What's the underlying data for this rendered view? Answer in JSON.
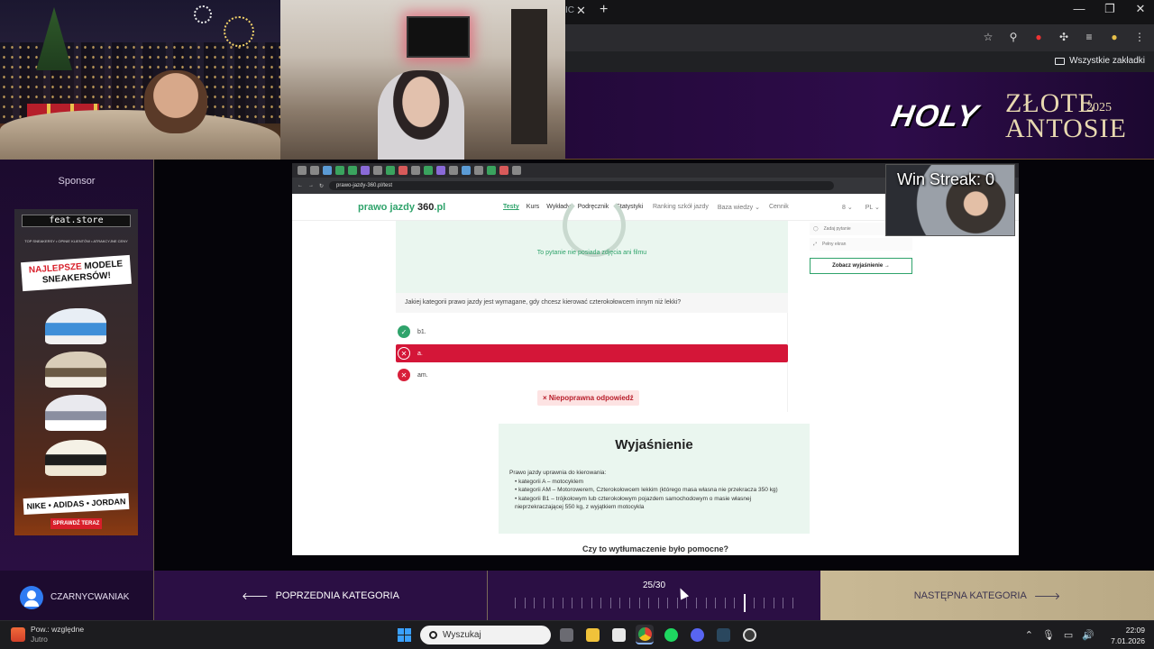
{
  "stream": {
    "sponsor_label": "Sponsor",
    "ad": {
      "logo": "feat.store",
      "tagline": "TOP SNEAKERSY • OPINIE KLIENTÓW • ATRAKCYJNE CENY",
      "headline_1": "NAJLEPSZE",
      "headline_2": "MODELE",
      "headline_3": "SNEAKERSÓW!",
      "brands": "NIKE • ADIDAS • JORDAN",
      "cta": "SPRAWDŹ TERAZ"
    },
    "banner": {
      "holy": "HOLY",
      "zlote": "ZŁOTE",
      "year": "2025",
      "antosie": "ANTOSIE"
    },
    "pip_label": "Win Streak: 0",
    "username": "CZARNYCWANIAK",
    "prev_label": "POPRZEDNIA KATEGORIA",
    "next_label": "NASTĘPNA KATEGORIA",
    "progress_label": "25/30",
    "progress": {
      "current": 25,
      "total": 30
    }
  },
  "chrome": {
    "tab_fragment": "IC",
    "bookmarks_label": "Wszystkie zakładki"
  },
  "inner_browser": {
    "url": "prawo-jazdy-360.pl/test",
    "logo_a": "prawo jazdy ",
    "logo_b": "360",
    "logo_c": ".pl",
    "nav": [
      "Testy",
      "Kurs",
      "Wykłady",
      "Podręcznik",
      "Statystyki"
    ],
    "nav_right": [
      "Ranking szkół jazdy",
      "Baza wiedzy ⌄",
      "Cennik"
    ],
    "lang": [
      "8 ⌄",
      "PL ⌄"
    ],
    "media_text": "To pytanie nie posiada zdjęcia ani filmu",
    "question": "Jakiej kategorii prawo jazdy jest wymagane, gdy chcesz kierować czterokołowcem innym niż lekki?",
    "answers": [
      {
        "label": "b1.",
        "state": "correct"
      },
      {
        "label": "a.",
        "state": "selected-wrong"
      },
      {
        "label": "am.",
        "state": "wrong"
      }
    ],
    "result": "× Niepoprawna odpowiedź",
    "side": {
      "ask": "Zadaj pytanie",
      "fullscreen": "Pełny ekran",
      "explain_btn": "Zobacz wyjaśnienie →"
    },
    "explanation": {
      "title": "Wyjaśnienie",
      "intro": "Prawo jazdy uprawnia do kierowania:",
      "items": [
        "kategorii A – motocyklem",
        "kategorii AM – Motorowerem, Czterokołowcem lekkim (którego masa własna nie przekracza 350 kg)",
        "kategorii B1 – trójkołowym lub czterokołowym pojazdem samochodowym o masie własnej nieprzekraczającej 550 kg, z wyjątkiem motocykla"
      ],
      "helpful": "Czy to wytłumaczenie było pomocne?"
    }
  },
  "taskbar": {
    "weather_title": "Pow.: względne",
    "weather_sub": "Jutro",
    "search_placeholder": "Wyszukaj",
    "time": "22:09",
    "date": "7.01.2026"
  }
}
